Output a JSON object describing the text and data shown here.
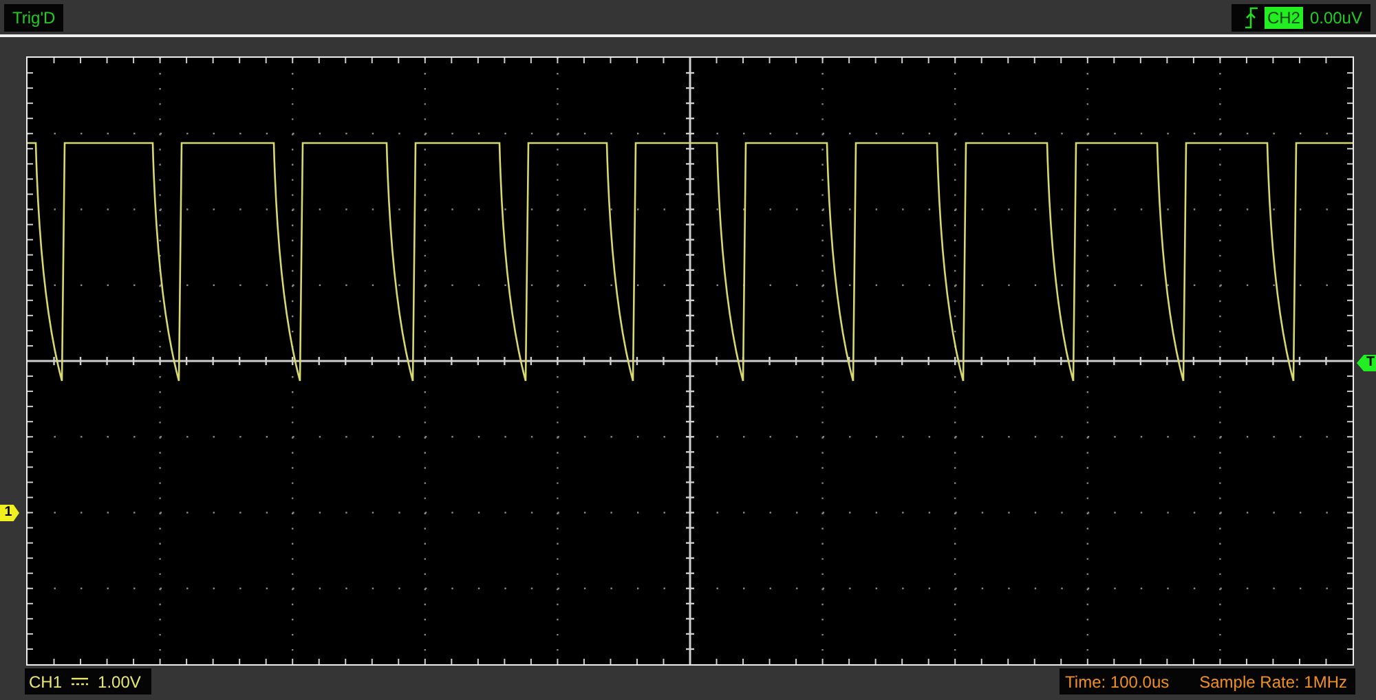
{
  "top_bar": {
    "trigger_state": "Trig'D",
    "trigger_source": "CH2",
    "trigger_level": "0.00uV"
  },
  "screen": {
    "channel_marker": "1",
    "trigger_marker": "T"
  },
  "bottom_bar": {
    "channel": "CH1",
    "volts_per_div": "1.00V",
    "time_base": "Time: 100.0us",
    "sample_rate": "Sample Rate: 1MHz"
  }
}
